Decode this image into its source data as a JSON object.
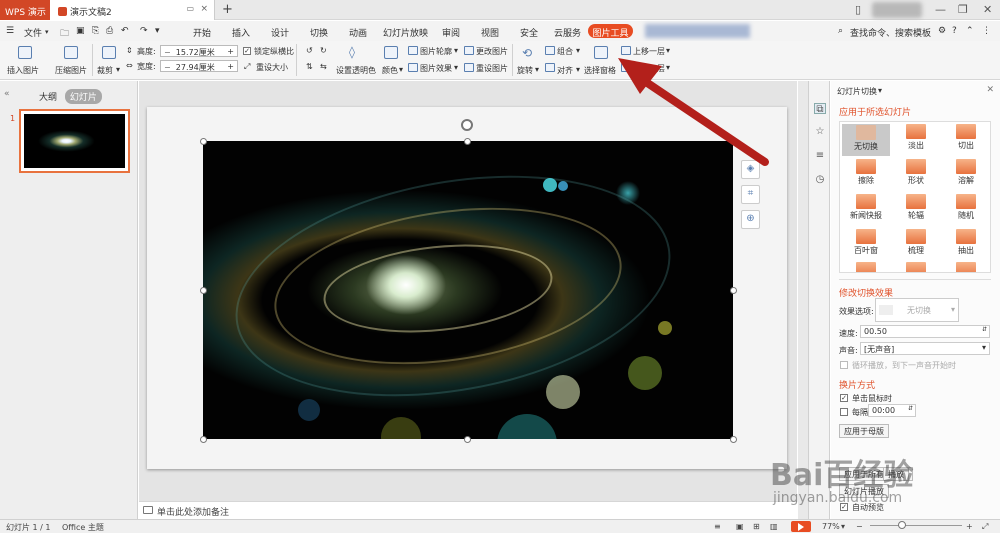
{
  "titlebar": {
    "app": "WPS 演示",
    "doc_tab": "演示文稿2",
    "new_tab": "+"
  },
  "menu": {
    "file": "文件",
    "items": [
      "开始",
      "插入",
      "设计",
      "切换",
      "动画",
      "幻灯片放映",
      "审阅",
      "视图",
      "安全",
      "云服务"
    ],
    "active_tab": "图片工具",
    "search": "查找命令、搜索模板"
  },
  "ribbon": {
    "insert_picture": "插入图片",
    "compress": "压缩图片",
    "crop": "裁剪",
    "height_label": "高度:",
    "height_value": "15.72厘米",
    "width_label": "宽度:",
    "width_value": "27.94厘米",
    "lock_ratio": "锁定纵横比",
    "reset_size": "重设大小",
    "set_transparent": "设置透明色",
    "color": "颜色",
    "outline": "图片轮廓",
    "effects": "图片效果",
    "change_picture": "更改图片",
    "reset_picture": "重设图片",
    "rotate": "旋转",
    "group": "组合",
    "align": "对齐",
    "selection_pane": "选择窗格",
    "bring_forward": "上移一层",
    "send_backward": "下移一层"
  },
  "left_pane": {
    "tabs": [
      "大纲",
      "幻灯片"
    ],
    "slide_number": "1"
  },
  "notes_placeholder": "单击此处添加备注",
  "right_panel": {
    "title": "幻灯片切换",
    "apply_title": "应用于所选幻灯片",
    "transitions": [
      "无切换",
      "淡出",
      "切出",
      "擦除",
      "形状",
      "溶解",
      "新闻快报",
      "轮辐",
      "随机",
      "百叶窗",
      "梳理",
      "抽出"
    ],
    "modify_title": "修改切换效果",
    "effect_label": "效果选项:",
    "effect_value": "无切换",
    "speed_label": "速度:",
    "speed_value": "00.50",
    "sound_label": "声音:",
    "sound_value": "[无声音]",
    "loop_label": "循环播放，到下一声音开始时",
    "advance_title": "换片方式",
    "on_click": "单击鼠标时",
    "every_label": "每隔",
    "every_value": "00:00",
    "apply_master": "应用于母版",
    "apply_all": "应用于所有幻灯片",
    "play": "播放",
    "slideshow": "幻灯片播放",
    "autopreview": "自动预览"
  },
  "status": {
    "slide": "幻灯片 1 / 1",
    "theme": "Office 主题",
    "zoom": "77%"
  },
  "watermark": {
    "brand": "Bai百经验",
    "url": "jingyan.baidu.com"
  }
}
